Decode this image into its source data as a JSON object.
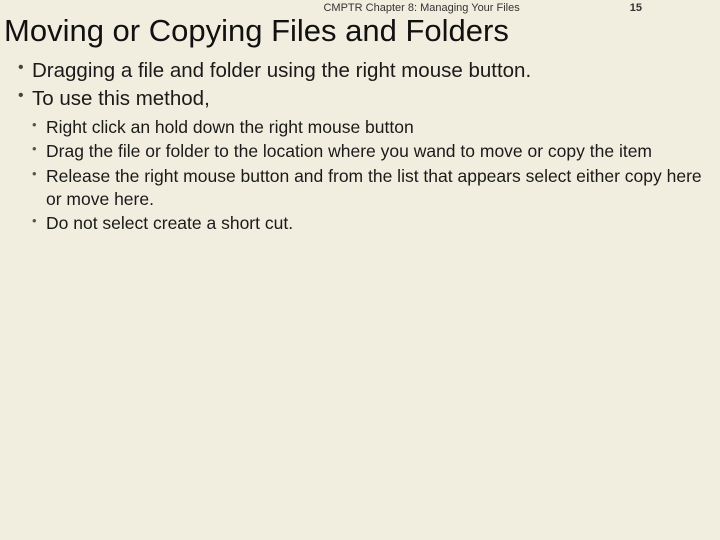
{
  "header": {
    "chapter": "CMPTR Chapter 8: Managing Your Files",
    "page_number": "15"
  },
  "title": "Moving or Copying Files and Folders",
  "bullets": [
    "Dragging a file and folder using the right mouse button.",
    "To use this method,"
  ],
  "subbullets": [
    "Right click an hold down the right mouse button",
    "Drag the file or folder to the location where you wand to move or copy the item",
    "Release the right mouse button and from the list that appears select either copy here or move here.",
    "Do not select create a short cut."
  ]
}
